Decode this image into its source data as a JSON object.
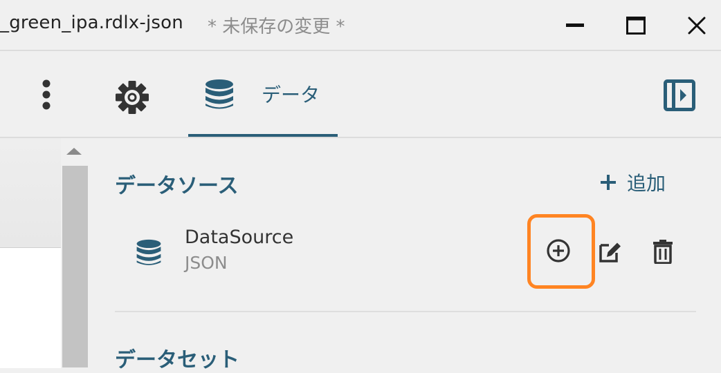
{
  "window": {
    "title": "_green_ipa.rdlx-json",
    "unsaved_indicator": "* 未保存の変更 *",
    "controls": [
      "minimize",
      "maximize",
      "close"
    ]
  },
  "toolbar": {
    "active_tab_label": "データ",
    "icons": [
      "more-vertical-icon",
      "gear-icon",
      "database-icon",
      "panel-toggle-icon"
    ]
  },
  "data_panel": {
    "datasource_section_title": "データソース",
    "add_label": "追加",
    "datasources": [
      {
        "name": "DataSource",
        "type": "JSON"
      }
    ],
    "dataset_section_title": "データセット"
  },
  "colors": {
    "accent": "#2a5e78",
    "highlight": "#ff8422",
    "background": "#f0f0f0",
    "icon_dark": "#333333"
  }
}
